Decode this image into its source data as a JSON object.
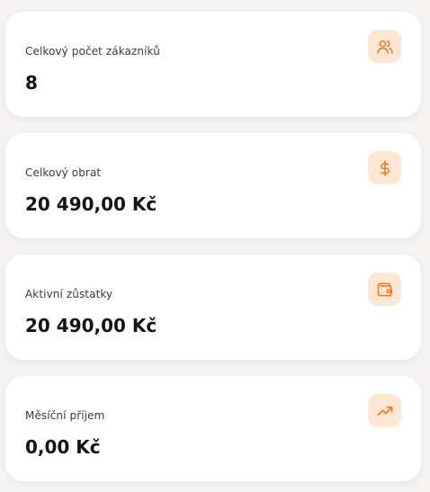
{
  "colors": {
    "accent": "#e8762b",
    "icon_bg": "#fde7d3",
    "page_bg": "#f4f3f2",
    "card_bg": "#ffffff"
  },
  "stats": [
    {
      "label": "Celkový počet zákazníků",
      "value": "8",
      "icon": "users-icon"
    },
    {
      "label": "Celkový obrat",
      "value": "20 490,00 Kč",
      "icon": "dollar-icon"
    },
    {
      "label": "Aktivní zůstatky",
      "value": "20 490,00 Kč",
      "icon": "wallet-icon"
    },
    {
      "label": "Měsíční příjem",
      "value": "0,00 Kč",
      "icon": "trending-up-icon"
    }
  ]
}
